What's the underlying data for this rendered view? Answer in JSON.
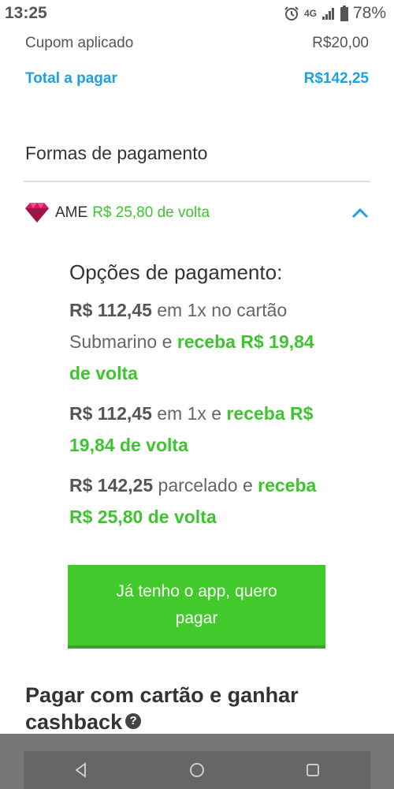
{
  "status_bar": {
    "time": "13:25",
    "network": "4G",
    "battery": "78%"
  },
  "summary": {
    "coupon_label": "Cupom aplicado",
    "coupon_value": "R$20,00",
    "total_label": "Total a pagar",
    "total_value": "R$142,25"
  },
  "payment": {
    "section_title": "Formas de pagamento",
    "ame": {
      "label": "AME",
      "cashback": "R$ 25,80 de volta",
      "expanded": true
    },
    "options_title": "Opções de pagamento:",
    "options": [
      {
        "price": "R$ 112,45",
        "text": " em 1x no cartão Submarino e ",
        "highlight": "receba R$ 19,84 de volta"
      },
      {
        "price": "R$ 112,45",
        "text": " em 1x e ",
        "highlight": "receba R$ 19,84 de volta"
      },
      {
        "price": "R$ 142,25",
        "text": " parcelado e ",
        "highlight": "receba R$ 25,80 de volta"
      }
    ],
    "cta_label": "Já tenho o app, quero pagar"
  },
  "cashback_section": {
    "title": "Pagar com cartão e ganhar cashback",
    "help_glyph": "?"
  },
  "colors": {
    "accent_blue": "#1da1e0",
    "green": "#3ec42f",
    "button_green": "#42c92b"
  }
}
